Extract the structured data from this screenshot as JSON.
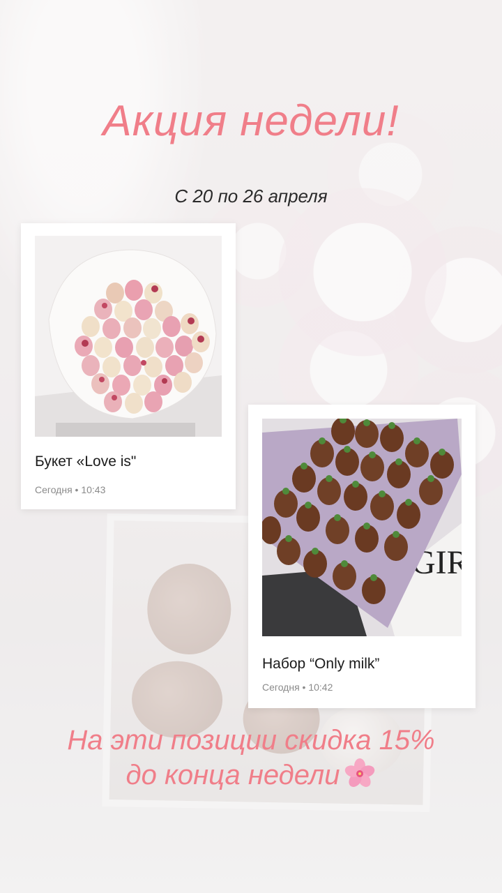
{
  "header": {
    "title": "Акция недели!",
    "date_range": "С 20 по 26 апреля"
  },
  "cards": [
    {
      "title": "Букет «Love is\"",
      "meta": "Сегодня • 10:43"
    },
    {
      "title": "Набор “Only milk”",
      "meta": "Сегодня • 10:42"
    }
  ],
  "footer": {
    "promo_line_1": "На эти позиции скидка 15%",
    "promo_line_2": "до конца недели"
  },
  "icons": {
    "promo_icon": "cherry-blossom-icon"
  },
  "colors": {
    "accent": "#f07e89",
    "card_background": "#ffffff"
  }
}
